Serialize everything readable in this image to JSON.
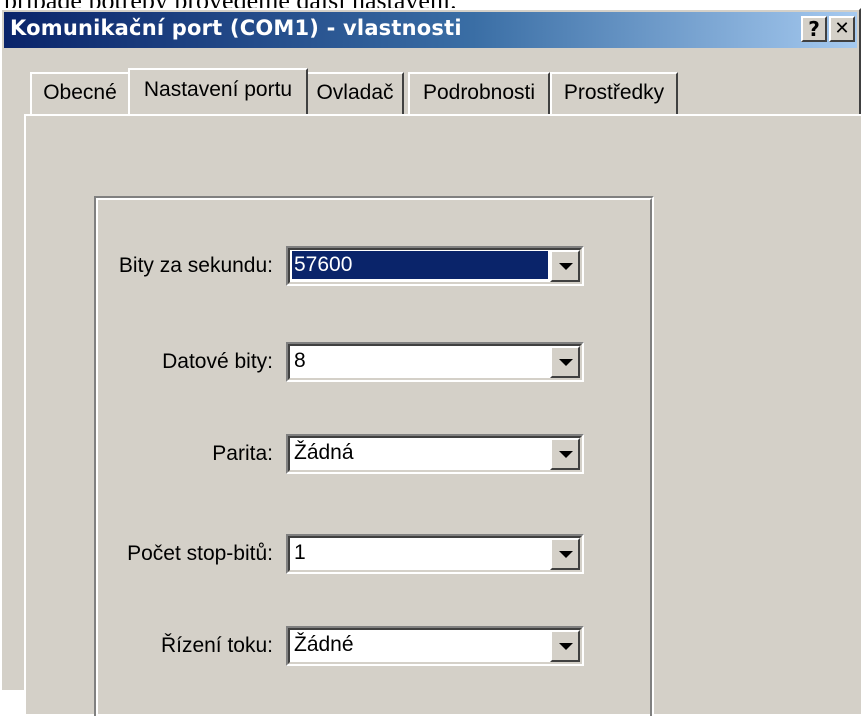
{
  "document": {
    "top_text": "případě potřeby provedeme další nastavení."
  },
  "window": {
    "title": "Komunikační port (COM1) - vlastnosti",
    "help_button": "?",
    "close_button": "✕"
  },
  "tabs": [
    {
      "label": "Obecné",
      "active": false
    },
    {
      "label": "Nastavení portu",
      "active": true
    },
    {
      "label": "Ovladač",
      "active": false
    },
    {
      "label": "Podrobnosti",
      "active": false
    },
    {
      "label": "Prostředky",
      "active": false
    }
  ],
  "settings": {
    "bits_per_second": {
      "label": "Bity za sekundu:",
      "value": "57600"
    },
    "data_bits": {
      "label": "Datové bity:",
      "value": "8"
    },
    "parity": {
      "label": "Parita:",
      "value": "Žádná"
    },
    "stop_bits": {
      "label": "Počet stop-bitů:",
      "value": "1"
    },
    "flow_control": {
      "label": "Řízení toku:",
      "value": "Žádné"
    }
  }
}
